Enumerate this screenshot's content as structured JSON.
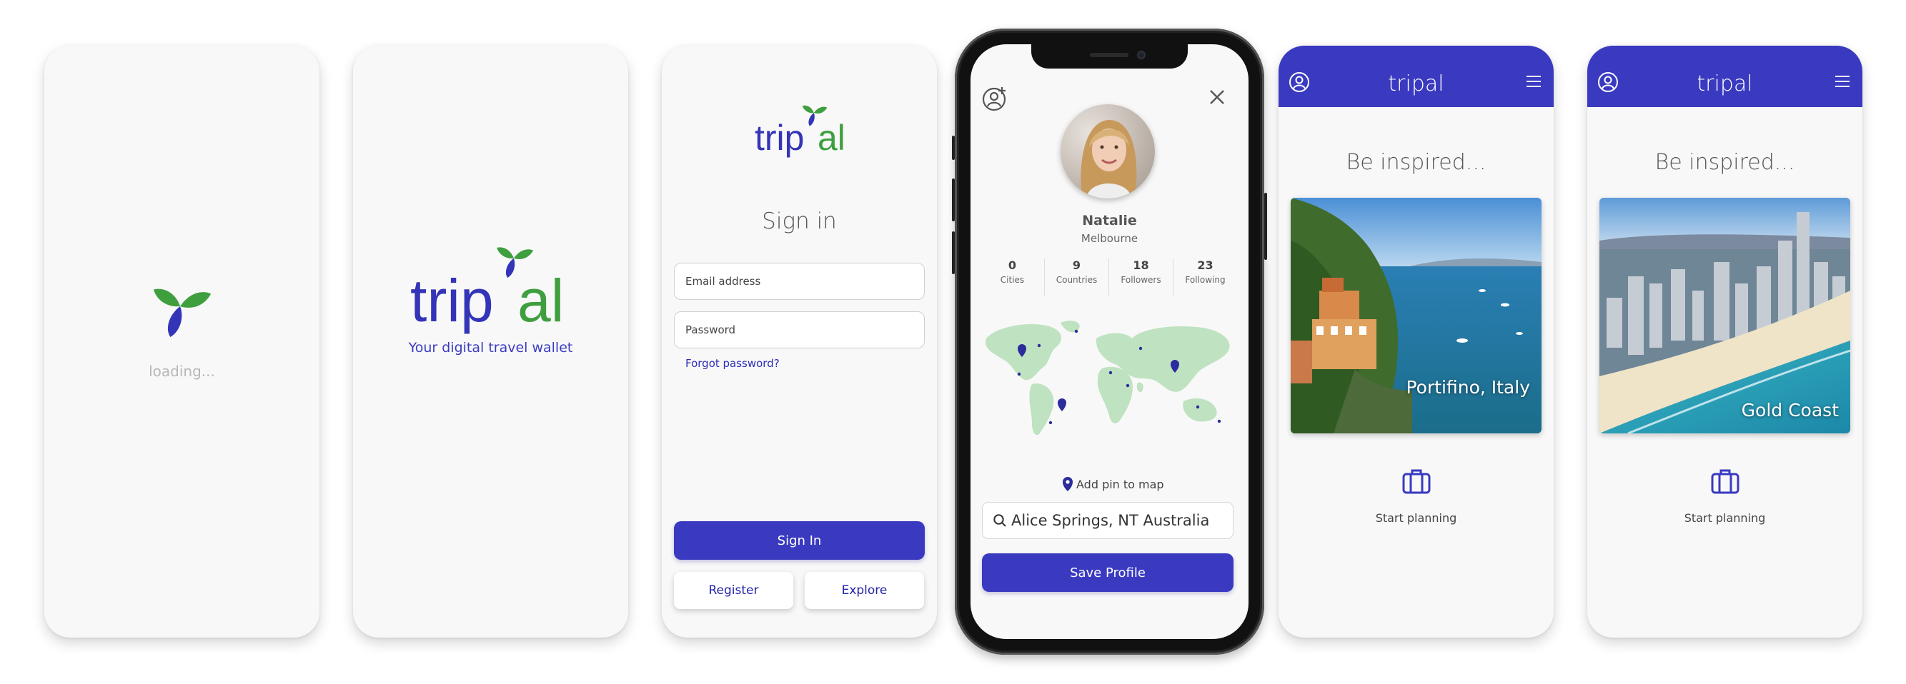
{
  "brand": {
    "name": "tripal",
    "tagline": "Your digital travel wallet",
    "primary_color": "#3a3ac1",
    "accent_color": "#3f9f3f"
  },
  "loading_screen": {
    "text": "loading..."
  },
  "signin_screen": {
    "title": "Sign in",
    "email_placeholder": "Email address",
    "password_placeholder": "Password",
    "forgot_link": "Forgot password?",
    "signin_button": "Sign In",
    "register_button": "Register",
    "explore_button": "Explore"
  },
  "profile_screen": {
    "add_friend_icon": "user-plus-icon",
    "close_icon": "close-icon",
    "name": "Natalie",
    "city": "Melbourne",
    "stats": [
      {
        "value": "0",
        "label": "Cities"
      },
      {
        "value": "9",
        "label": "Countries"
      },
      {
        "value": "18",
        "label": "Followers"
      },
      {
        "value": "23",
        "label": "Following"
      }
    ],
    "add_pin_label": "Add pin to map",
    "search_value": "Alice Springs, NT Australia",
    "save_button": "Save Profile"
  },
  "inspire_screens": [
    {
      "heading": "Be inspired...",
      "destination": "Portifino, Italy",
      "action_label": "Start planning"
    },
    {
      "heading": "Be inspired...",
      "destination": "Gold Coast",
      "action_label": "Start planning"
    }
  ]
}
